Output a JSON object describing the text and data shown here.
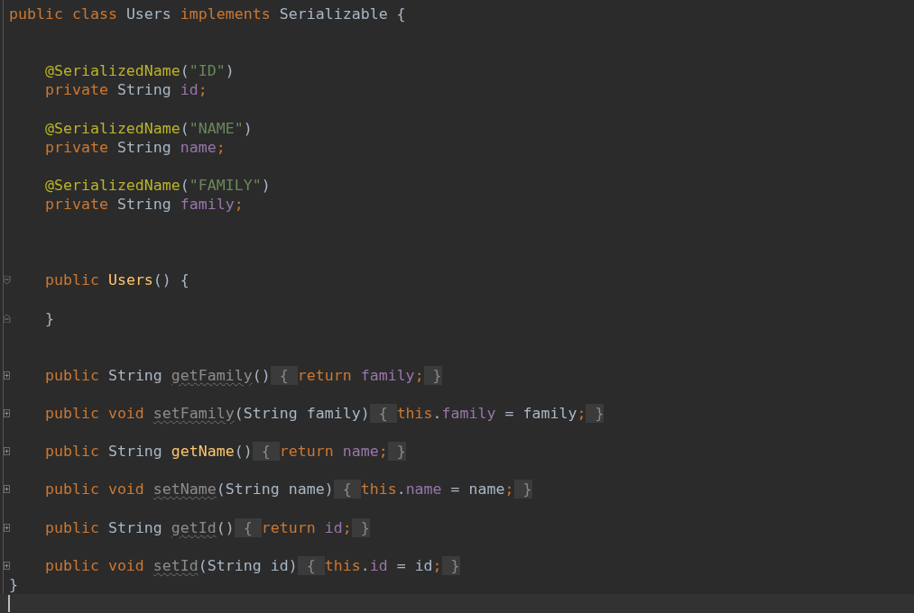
{
  "editor": {
    "lines": [
      {
        "kind": "code",
        "tokens": [
          {
            "kind": "kw",
            "text": "public class "
          },
          {
            "kind": "plain",
            "text": "Users "
          },
          {
            "kind": "kw",
            "text": "implements "
          },
          {
            "kind": "plain",
            "text": "Serializable {"
          }
        ]
      },
      {
        "kind": "blank"
      },
      {
        "kind": "blank"
      },
      {
        "kind": "code",
        "tokens": [
          {
            "kind": "ann",
            "text": "    @SerializedName"
          },
          {
            "kind": "plain",
            "text": "("
          },
          {
            "kind": "str",
            "text": "\"ID\""
          },
          {
            "kind": "plain",
            "text": ")"
          }
        ]
      },
      {
        "kind": "code",
        "tokens": [
          {
            "kind": "kw",
            "text": "    private "
          },
          {
            "kind": "plain",
            "text": "String "
          },
          {
            "kind": "field",
            "text": "id"
          },
          {
            "kind": "kw",
            "text": ";"
          }
        ]
      },
      {
        "kind": "blank"
      },
      {
        "kind": "code",
        "tokens": [
          {
            "kind": "ann",
            "text": "    @SerializedName"
          },
          {
            "kind": "plain",
            "text": "("
          },
          {
            "kind": "str",
            "text": "\"NAME\""
          },
          {
            "kind": "plain",
            "text": ")"
          }
        ]
      },
      {
        "kind": "code",
        "tokens": [
          {
            "kind": "kw",
            "text": "    private "
          },
          {
            "kind": "plain",
            "text": "String "
          },
          {
            "kind": "field",
            "text": "name"
          },
          {
            "kind": "kw",
            "text": ";"
          }
        ]
      },
      {
        "kind": "blank"
      },
      {
        "kind": "code",
        "tokens": [
          {
            "kind": "ann",
            "text": "    @SerializedName"
          },
          {
            "kind": "plain",
            "text": "("
          },
          {
            "kind": "str",
            "text": "\"FAMILY\""
          },
          {
            "kind": "plain",
            "text": ")"
          }
        ]
      },
      {
        "kind": "code",
        "tokens": [
          {
            "kind": "kw",
            "text": "    private "
          },
          {
            "kind": "plain",
            "text": "String "
          },
          {
            "kind": "field",
            "text": "family"
          },
          {
            "kind": "kw",
            "text": ";"
          }
        ]
      },
      {
        "kind": "blank"
      },
      {
        "kind": "blank"
      },
      {
        "kind": "blank"
      },
      {
        "kind": "code",
        "fold_marker": {
          "kind": "open"
        },
        "tokens": [
          {
            "kind": "kw",
            "text": "    public "
          },
          {
            "kind": "decl",
            "text": "Users"
          },
          {
            "kind": "plain",
            "text": "() {"
          }
        ]
      },
      {
        "kind": "blank"
      },
      {
        "kind": "code",
        "fold_marker": {
          "kind": "end"
        },
        "tokens": [
          {
            "kind": "plain",
            "text": "    }"
          }
        ]
      },
      {
        "kind": "blank"
      },
      {
        "kind": "blank"
      },
      {
        "kind": "code",
        "fold_marker": {
          "kind": "collapsed"
        },
        "tokens": [
          {
            "kind": "kw",
            "text": "    public "
          },
          {
            "kind": "plain",
            "text": "String "
          },
          {
            "kind": "unused",
            "text": "getFamily"
          },
          {
            "kind": "plain",
            "text": "()"
          },
          {
            "kind": "folded",
            "text": " { "
          },
          {
            "kind": "kw",
            "text": "return "
          },
          {
            "kind": "field",
            "text": "family"
          },
          {
            "kind": "kw",
            "text": ";"
          },
          {
            "kind": "folded",
            "text": " }"
          }
        ]
      },
      {
        "kind": "blank"
      },
      {
        "kind": "code",
        "fold_marker": {
          "kind": "collapsed"
        },
        "tokens": [
          {
            "kind": "kw",
            "text": "    public void "
          },
          {
            "kind": "unused",
            "text": "setFamily"
          },
          {
            "kind": "plain",
            "text": "(String family)"
          },
          {
            "kind": "folded",
            "text": " { "
          },
          {
            "kind": "kw",
            "text": "this"
          },
          {
            "kind": "plain",
            "text": "."
          },
          {
            "kind": "field",
            "text": "family"
          },
          {
            "kind": "plain",
            "text": " = family"
          },
          {
            "kind": "kw",
            "text": ";"
          },
          {
            "kind": "folded",
            "text": " }"
          }
        ]
      },
      {
        "kind": "blank"
      },
      {
        "kind": "code",
        "fold_marker": {
          "kind": "collapsed"
        },
        "tokens": [
          {
            "kind": "kw",
            "text": "    public "
          },
          {
            "kind": "plain",
            "text": "String "
          },
          {
            "kind": "decl",
            "text": "getName"
          },
          {
            "kind": "plain",
            "text": "()"
          },
          {
            "kind": "folded",
            "text": " { "
          },
          {
            "kind": "kw",
            "text": "return "
          },
          {
            "kind": "field",
            "text": "name"
          },
          {
            "kind": "kw",
            "text": ";"
          },
          {
            "kind": "folded",
            "text": " }"
          }
        ]
      },
      {
        "kind": "blank"
      },
      {
        "kind": "code",
        "fold_marker": {
          "kind": "collapsed"
        },
        "tokens": [
          {
            "kind": "kw",
            "text": "    public void "
          },
          {
            "kind": "unused",
            "text": "setName"
          },
          {
            "kind": "plain",
            "text": "(String name)"
          },
          {
            "kind": "folded",
            "text": " { "
          },
          {
            "kind": "kw",
            "text": "this"
          },
          {
            "kind": "plain",
            "text": "."
          },
          {
            "kind": "field",
            "text": "name"
          },
          {
            "kind": "plain",
            "text": " = name"
          },
          {
            "kind": "kw",
            "text": ";"
          },
          {
            "kind": "folded",
            "text": " }"
          }
        ]
      },
      {
        "kind": "blank"
      },
      {
        "kind": "code",
        "fold_marker": {
          "kind": "collapsed"
        },
        "tokens": [
          {
            "kind": "kw",
            "text": "    public "
          },
          {
            "kind": "plain",
            "text": "String "
          },
          {
            "kind": "unused",
            "text": "getId"
          },
          {
            "kind": "plain",
            "text": "()"
          },
          {
            "kind": "folded",
            "text": " { "
          },
          {
            "kind": "kw",
            "text": "return "
          },
          {
            "kind": "field",
            "text": "id"
          },
          {
            "kind": "kw",
            "text": ";"
          },
          {
            "kind": "folded",
            "text": " }"
          }
        ]
      },
      {
        "kind": "blank"
      },
      {
        "kind": "code",
        "fold_marker": {
          "kind": "collapsed"
        },
        "tokens": [
          {
            "kind": "kw",
            "text": "    public void "
          },
          {
            "kind": "unused",
            "text": "setId"
          },
          {
            "kind": "plain",
            "text": "(String id)"
          },
          {
            "kind": "folded",
            "text": " { "
          },
          {
            "kind": "kw",
            "text": "this"
          },
          {
            "kind": "plain",
            "text": "."
          },
          {
            "kind": "field",
            "text": "id"
          },
          {
            "kind": "plain",
            "text": " = id"
          },
          {
            "kind": "kw",
            "text": ";"
          },
          {
            "kind": "folded",
            "text": " }"
          }
        ]
      },
      {
        "kind": "code",
        "tokens": [
          {
            "kind": "plain",
            "text": "}"
          }
        ]
      },
      {
        "kind": "caret"
      }
    ]
  }
}
